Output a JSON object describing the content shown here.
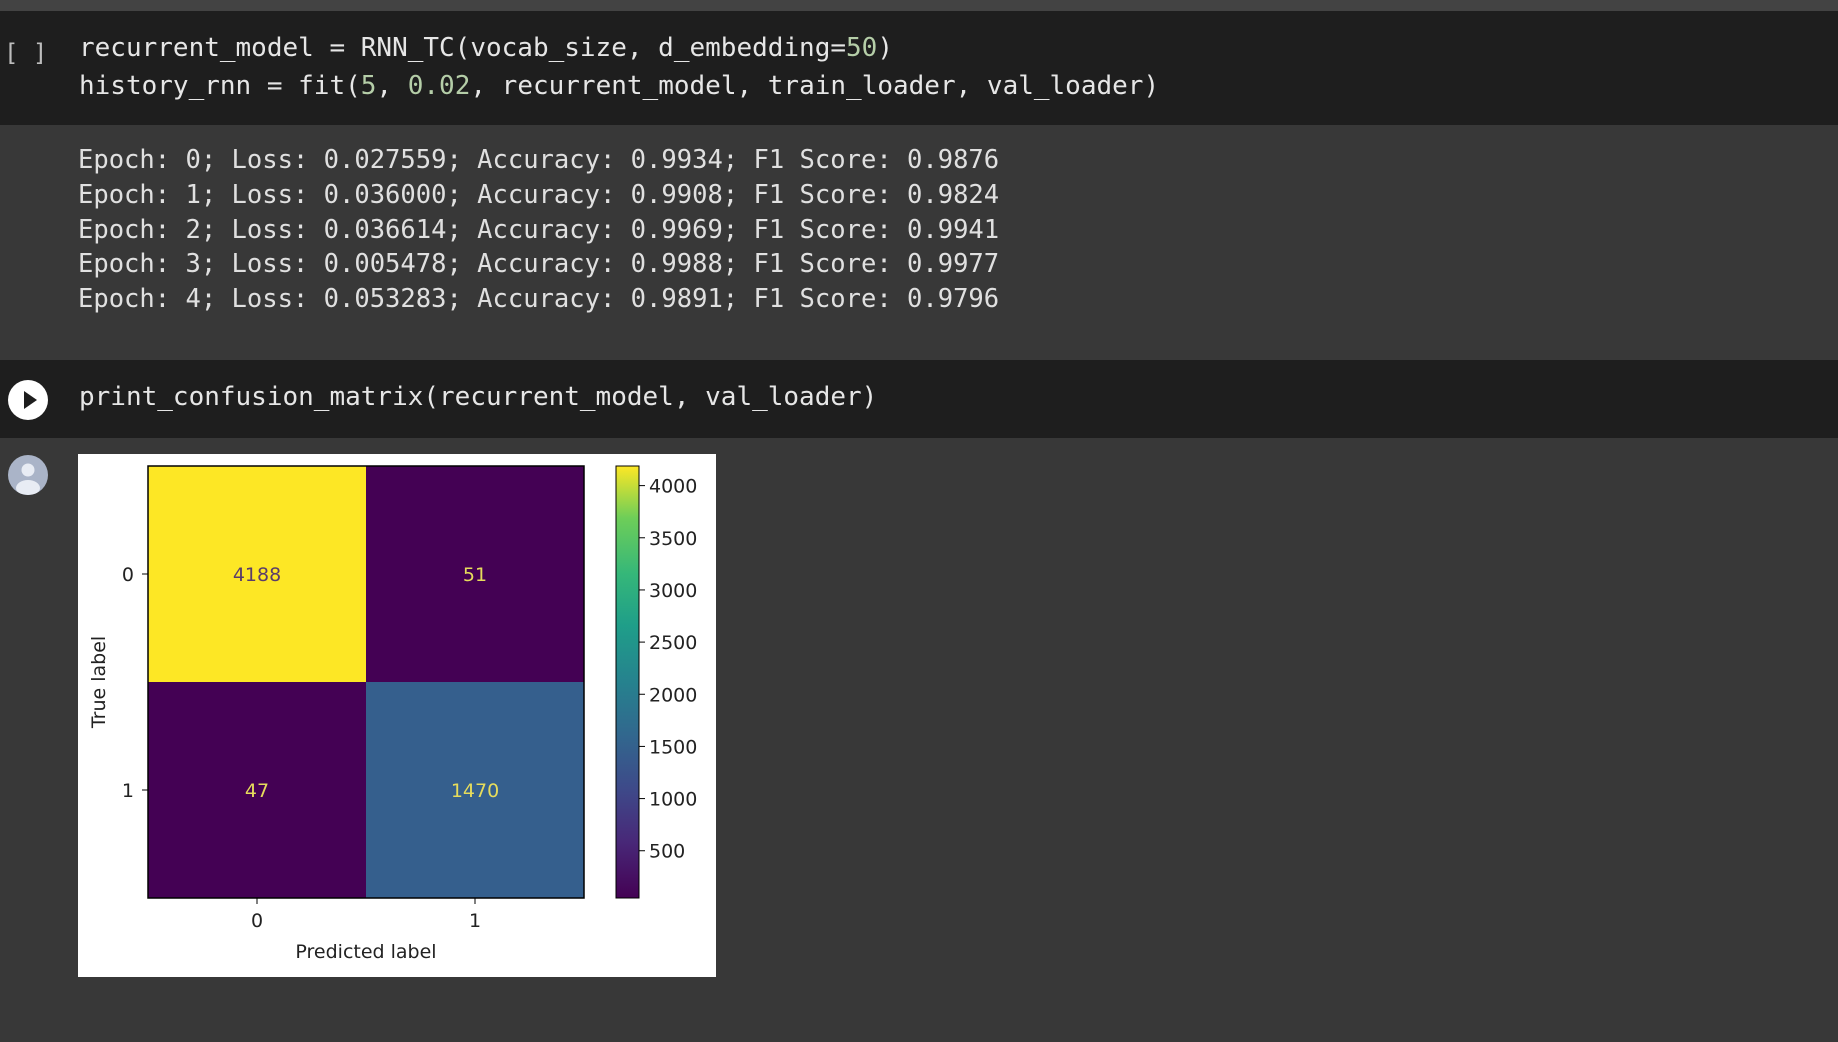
{
  "cell1": {
    "gutter": "[ ]",
    "code": {
      "line1_prefix": "recurrent_model = RNN_TC(vocab_size, d_embedding=",
      "line1_num": "50",
      "line1_suffix": ")",
      "line2_prefix": "history_rnn = fit(",
      "line2_num1": "5",
      "line2_sep": ", ",
      "line2_num2": "0.02",
      "line2_suffix": ", recurrent_model, train_loader, val_loader)"
    }
  },
  "output1": {
    "lines": [
      "Epoch: 0; Loss: 0.027559; Accuracy: 0.9934; F1 Score: 0.9876",
      "Epoch: 1; Loss: 0.036000; Accuracy: 0.9908; F1 Score: 0.9824",
      "Epoch: 2; Loss: 0.036614; Accuracy: 0.9969; F1 Score: 0.9941",
      "Epoch: 3; Loss: 0.005478; Accuracy: 0.9988; F1 Score: 0.9977",
      "Epoch: 4; Loss: 0.053283; Accuracy: 0.9891; F1 Score: 0.9796"
    ]
  },
  "cell2": {
    "code": "print_confusion_matrix(recurrent_model, val_loader)",
    "run_icon": "play-icon"
  },
  "output2": {
    "avatar_icon": "user-avatar-icon"
  },
  "colors": {
    "code_bg": "#1e1e1e",
    "output_bg": "#383838",
    "number": "#b5cea8"
  },
  "chart_data": {
    "type": "heatmap",
    "title": "",
    "xlabel": "Predicted label",
    "ylabel": "True label",
    "x_categories": [
      "0",
      "1"
    ],
    "y_categories": [
      "0",
      "1"
    ],
    "values": [
      [
        4188,
        51
      ],
      [
        47,
        1470
      ]
    ],
    "colormap": "viridis",
    "colorbar_range": [
      47,
      4188
    ],
    "colorbar_ticks": [
      "500",
      "1000",
      "1500",
      "2000",
      "2500",
      "3000",
      "3500",
      "4000"
    ]
  }
}
